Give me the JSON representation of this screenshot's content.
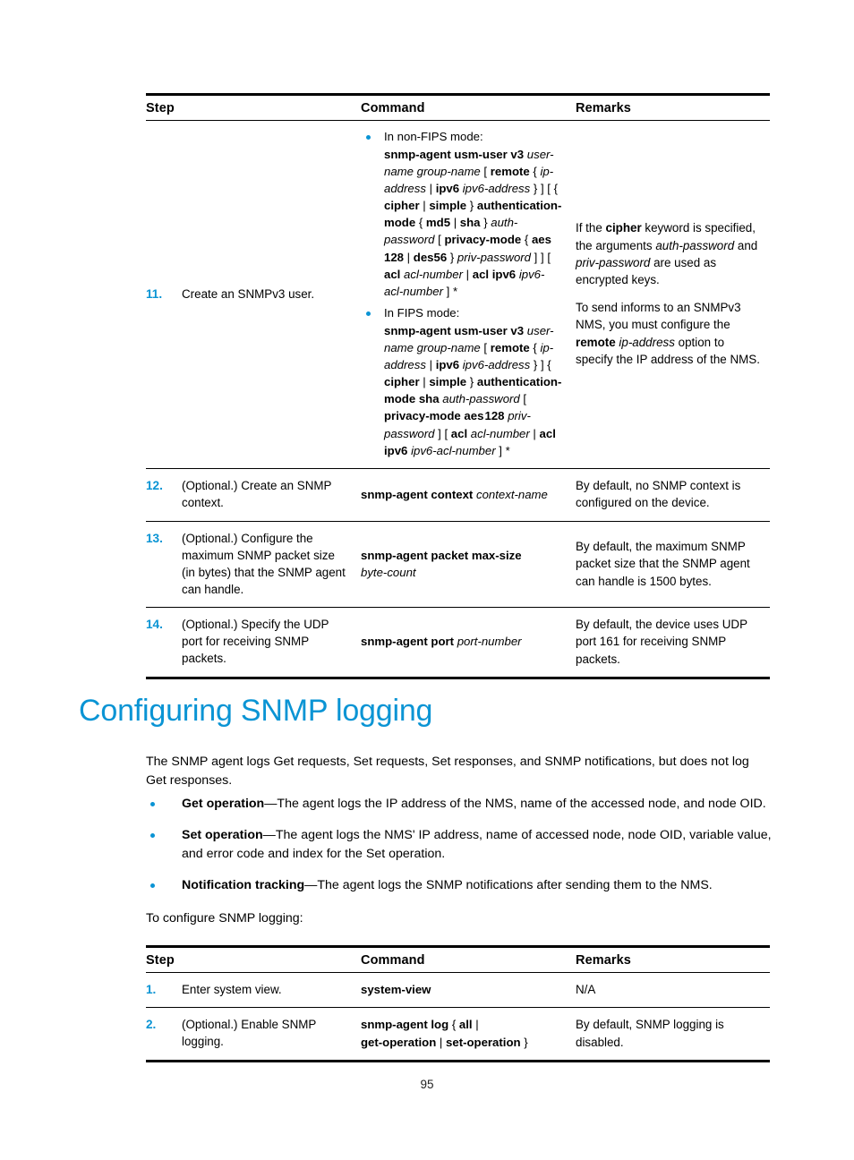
{
  "page": {
    "number": "95"
  },
  "table_top": {
    "headers": {
      "step": "Step",
      "command": "Command",
      "remarks": "Remarks"
    },
    "rows": [
      {
        "num": "11.",
        "step": "Create an SNMPv3 user.",
        "command_variants": [
          {
            "head": "In non-FIPS mode:",
            "body": "snmp-agent usm-user v3 user-name group-name [ remote { ip-address | ipv6 ipv6-address } ] [ { cipher | simple } authentication-mode { md5 | sha } auth-password [ privacy-mode { aes 128 | des56 } priv-password ] ] [ acl acl-number | acl ipv6 ipv6-acl-number ] *"
          },
          {
            "head": "In FIPS mode:",
            "body": "snmp-agent usm-user v3 user-name group-name [ remote { ip-address | ipv6 ipv6-address } ] { cipher | simple } authentication-mode sha auth-password [ privacy-mode aes 128 priv-password ] [ acl acl-number | acl ipv6 ipv6-acl-number ] *"
          }
        ],
        "remarks": [
          "If the cipher keyword is specified, the arguments auth-password and priv-password are used as encrypted keys.",
          "To send informs to an SNMPv3 NMS, you must configure the remote ip-address option to specify the IP address of the NMS."
        ]
      },
      {
        "num": "12.",
        "step": "(Optional.) Create an SNMP context.",
        "command": "snmp-agent context context-name",
        "remarks": [
          "By default, no SNMP context is configured on the device."
        ]
      },
      {
        "num": "13.",
        "step": "(Optional.) Configure the maximum SNMP packet size (in bytes) that the SNMP agent can handle.",
        "command": "snmp-agent packet max-size byte-count",
        "remarks": [
          "By default, the maximum SNMP packet size that the SNMP agent can handle is 1500 bytes."
        ]
      },
      {
        "num": "14.",
        "step": "(Optional.) Specify the UDP port for receiving SNMP packets.",
        "command": "snmp-agent port port-number",
        "remarks": [
          "By default, the device uses UDP port 161 for receiving SNMP packets."
        ]
      }
    ]
  },
  "section": {
    "title": "Configuring SNMP logging",
    "intro": "The SNMP agent logs Get requests, Set requests, Set responses, and SNMP notifications, but does not log Get responses.",
    "bullets": [
      {
        "term": "Get operation",
        "text": "—The agent logs the IP address of the NMS, name of the accessed node, and node OID."
      },
      {
        "term": "Set operation",
        "text": "—The agent logs the NMS' IP address, name of accessed node, node OID, variable value, and error code and index for the Set operation."
      },
      {
        "term": "Notification tracking",
        "text": "—The agent logs the SNMP notifications after sending them to the NMS."
      }
    ],
    "lead_in": "To configure SNMP logging:"
  },
  "table_bottom": {
    "headers": {
      "step": "Step",
      "command": "Command",
      "remarks": "Remarks"
    },
    "rows": [
      {
        "num": "1.",
        "step": "Enter system view.",
        "command": "system-view",
        "remarks": [
          "N/A"
        ]
      },
      {
        "num": "2.",
        "step": "(Optional.) Enable SNMP logging.",
        "command": "snmp-agent log { all | get-operation | set-operation }",
        "remarks": [
          "By default, SNMP logging is disabled."
        ]
      }
    ]
  },
  "colors": {
    "accent_blue": "#0a94d4",
    "text_black": "#000000"
  }
}
